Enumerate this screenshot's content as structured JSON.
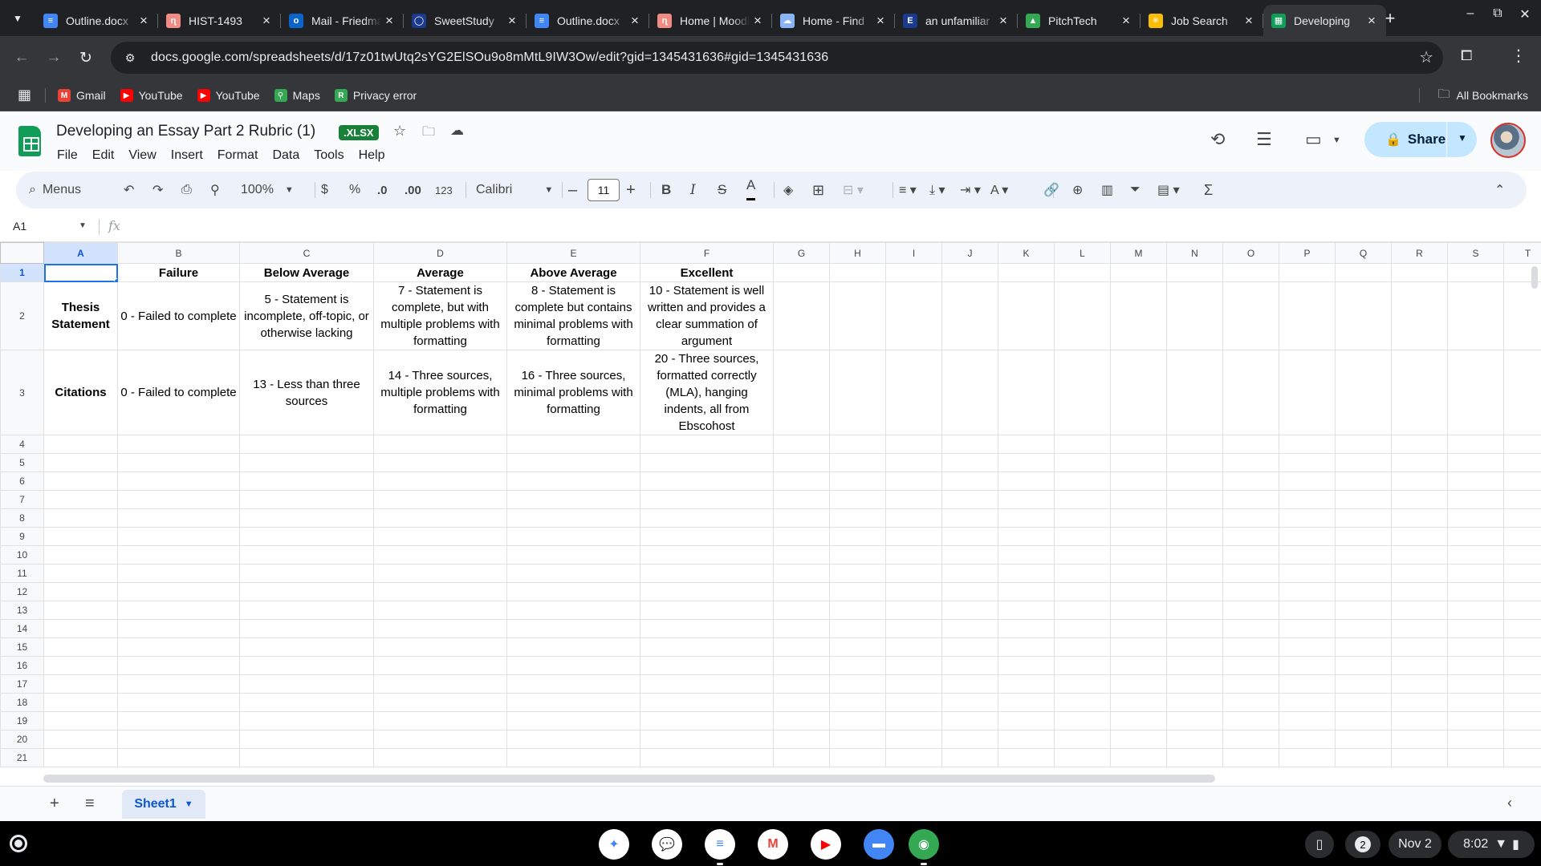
{
  "browser": {
    "tabs": [
      {
        "title": "Outline.docx",
        "favicon": "docs-icon",
        "color": "#4285f4",
        "glyph": "≡"
      },
      {
        "title": "HIST-1493",
        "favicon": "nu-icon",
        "color": "#f28b82",
        "glyph": "ɳ"
      },
      {
        "title": "Mail - Friedman",
        "favicon": "outlook-icon",
        "color": "#0a64c9",
        "glyph": "o"
      },
      {
        "title": "SweetStudy",
        "favicon": "sweetstudy-icon",
        "color": "#1a3a8f",
        "glyph": "◯"
      },
      {
        "title": "Outline.docx",
        "favicon": "docs-icon",
        "color": "#4285f4",
        "glyph": "≡"
      },
      {
        "title": "Home | Moodle",
        "favicon": "nu-icon",
        "color": "#f28b82",
        "glyph": "ɳ"
      },
      {
        "title": "Home - Find",
        "favicon": "cloud-icon",
        "color": "#8ab4f8",
        "glyph": "☁"
      },
      {
        "title": "an unfamiliar",
        "favicon": "e-icon",
        "color": "#1a3a8f",
        "glyph": "E"
      },
      {
        "title": "PitchTech",
        "favicon": "drive-icon",
        "color": "#34a853",
        "glyph": "▲"
      },
      {
        "title": "Job Search",
        "favicon": "walmart-icon",
        "color": "#fbbc04",
        "glyph": "✳"
      },
      {
        "title": "Developing",
        "favicon": "sheets-icon",
        "color": "#0f9d58",
        "glyph": "▦"
      }
    ],
    "active_tab": 10,
    "url": "docs.google.com/spreadsheets/d/17z01twUtq2sYG2ElSOu9o8mMtL9IW3Ow/edit?gid=1345431636#gid=1345431636",
    "bookmarks": [
      {
        "label": "Gmail",
        "color": "#ea4335",
        "glyph": "M"
      },
      {
        "label": "YouTube",
        "color": "#ff0000",
        "glyph": "▶"
      },
      {
        "label": "YouTube",
        "color": "#ff0000",
        "glyph": "▶"
      },
      {
        "label": "Maps",
        "color": "#34a853",
        "glyph": "⚲"
      },
      {
        "label": "Privacy error",
        "color": "#34a853",
        "glyph": "R"
      }
    ],
    "all_bookmarks": "All Bookmarks"
  },
  "sheets": {
    "title": "Developing an Essay Part 2 Rubric (1)",
    "badge": ".XLSX",
    "menu": [
      "File",
      "Edit",
      "View",
      "Insert",
      "Format",
      "Data",
      "Tools",
      "Help"
    ],
    "share_label": "Share",
    "toolbar": {
      "menus_label": "Menus",
      "zoom": "100%",
      "currency": "$",
      "percent": "%",
      "decrease_decimal": ".0",
      "increase_decimal": ".00",
      "number_format": "123",
      "font": "Calibri",
      "font_size": "11"
    },
    "name_box": "A1",
    "formula": "",
    "columns": [
      "A",
      "B",
      "C",
      "D",
      "E",
      "F",
      "G",
      "H",
      "I",
      "J",
      "K",
      "L",
      "M",
      "N",
      "O",
      "P",
      "Q",
      "R",
      "S",
      "T"
    ],
    "rows": [
      [
        "",
        "Failure",
        "Below Average",
        "Average",
        "Above Average",
        "Excellent"
      ],
      [
        "Thesis Statement",
        "0 - Failed to complete",
        "5 - Statement is incomplete, off-topic, or otherwise lacking",
        "7 - Statement is complete, but with multiple problems with formatting",
        "8 - Statement is complete but contains minimal problems with formatting",
        "10 - Statement is well written and provides a clear summation of argument"
      ],
      [
        "Citations",
        "0 - Failed to complete",
        "13 - Less than three sources",
        "14 - Three sources, multiple problems with formatting",
        "16 - Three sources, minimal problems with formatting",
        "20 - Three sources, formatted correctly (MLA), hanging indents, all from Ebscohost"
      ]
    ],
    "visible_row_count": 21,
    "sheet_tab": "Sheet1"
  },
  "shelf": {
    "apps": [
      {
        "name": "gemini-icon",
        "bg": "#ffffff",
        "fg": "#4285f4",
        "glyph": "✦"
      },
      {
        "name": "messages-icon",
        "bg": "#ffffff",
        "fg": "#1a73e8",
        "glyph": "💬"
      },
      {
        "name": "docs-icon",
        "bg": "#ffffff",
        "fg": "#4285f4",
        "glyph": "≡"
      },
      {
        "name": "gmail-icon",
        "bg": "#ffffff",
        "fg": "#ea4335",
        "glyph": "M"
      },
      {
        "name": "youtube-icon",
        "bg": "#ffffff",
        "fg": "#ff0000",
        "glyph": "▶"
      },
      {
        "name": "files-icon",
        "bg": "#4285f4",
        "fg": "#ffffff",
        "glyph": "▬"
      },
      {
        "name": "chrome-icon",
        "bg": "#34a853",
        "fg": "#ffffff",
        "glyph": "◉"
      }
    ],
    "notification_count": "2",
    "date": "Nov 2",
    "time": "8:02"
  }
}
